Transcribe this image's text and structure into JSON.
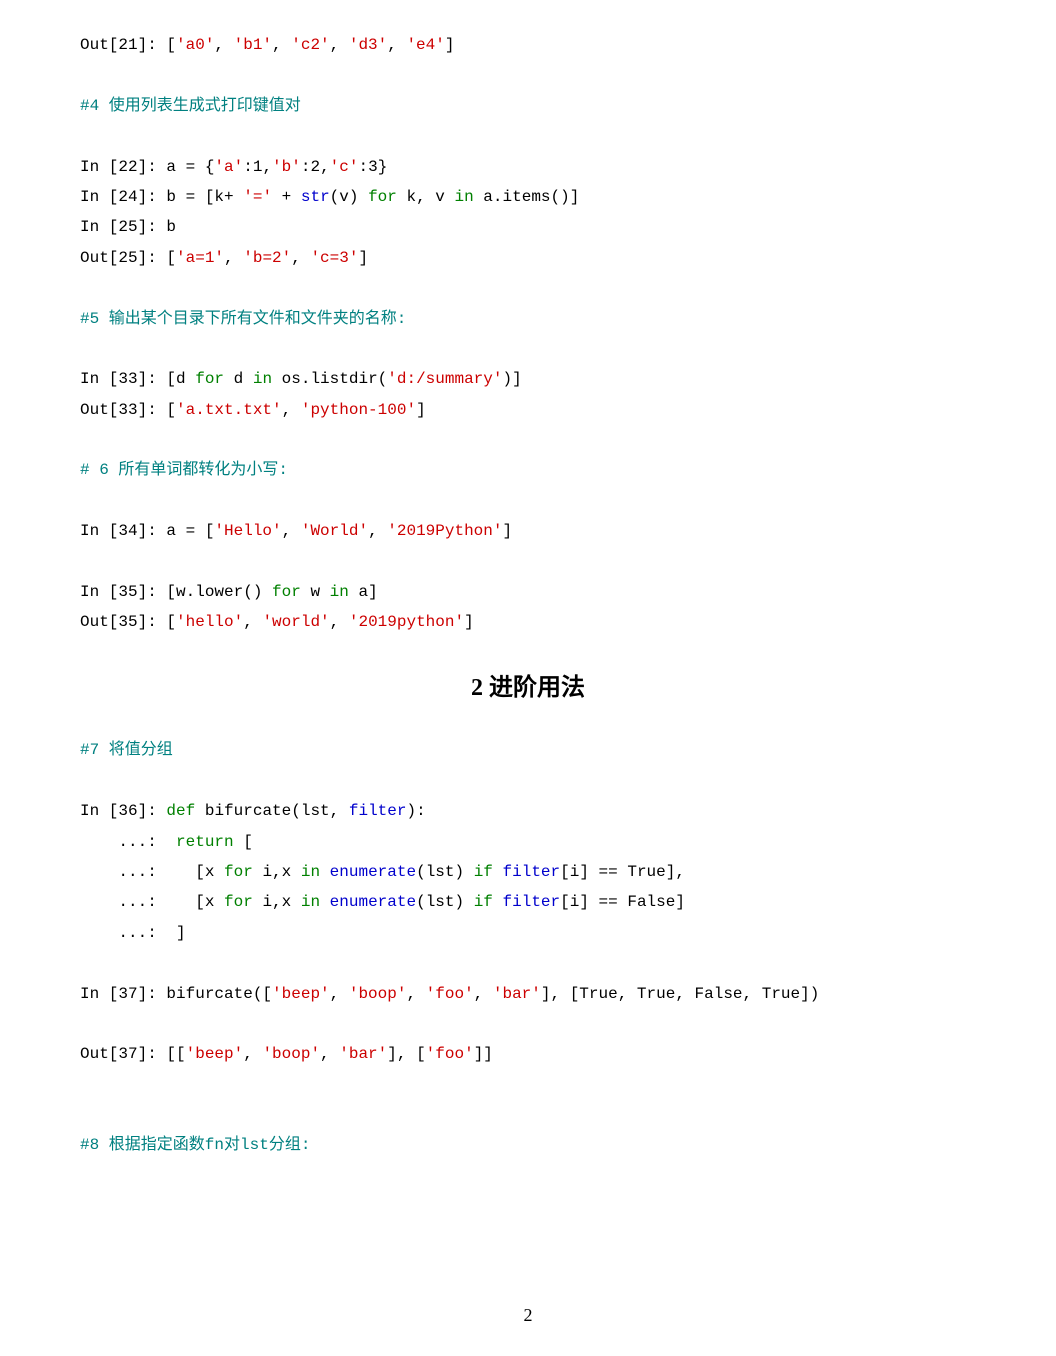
{
  "lines": [
    {
      "segs": [
        {
          "t": "Out[21]: ["
        },
        {
          "t": "'a0'",
          "c": "red"
        },
        {
          "t": ", "
        },
        {
          "t": "'b1'",
          "c": "red"
        },
        {
          "t": ", "
        },
        {
          "t": "'c2'",
          "c": "red"
        },
        {
          "t": ", "
        },
        {
          "t": "'d3'",
          "c": "red"
        },
        {
          "t": ", "
        },
        {
          "t": "'e4'",
          "c": "red"
        },
        {
          "t": "]"
        }
      ]
    },
    {
      "blank": true
    },
    {
      "segs": [
        {
          "t": "#4 使用列表生成式打印键值对",
          "c": "teal"
        }
      ]
    },
    {
      "blank": true
    },
    {
      "segs": [
        {
          "t": "In [22]: a = {"
        },
        {
          "t": "'a'",
          "c": "red"
        },
        {
          "t": ":1,"
        },
        {
          "t": "'b'",
          "c": "red"
        },
        {
          "t": ":2,"
        },
        {
          "t": "'c'",
          "c": "red"
        },
        {
          "t": ":3}"
        }
      ]
    },
    {
      "segs": [
        {
          "t": "In [24]: b = [k+ "
        },
        {
          "t": "'='",
          "c": "red"
        },
        {
          "t": " + "
        },
        {
          "t": "str",
          "c": "blue"
        },
        {
          "t": "(v) "
        },
        {
          "t": "for",
          "c": "green"
        },
        {
          "t": " k, v "
        },
        {
          "t": "in",
          "c": "green"
        },
        {
          "t": " a.items()]"
        }
      ]
    },
    {
      "segs": [
        {
          "t": "In [25]: b"
        }
      ]
    },
    {
      "segs": [
        {
          "t": "Out[25]: ["
        },
        {
          "t": "'a=1'",
          "c": "red"
        },
        {
          "t": ", "
        },
        {
          "t": "'b=2'",
          "c": "red"
        },
        {
          "t": ", "
        },
        {
          "t": "'c=3'",
          "c": "red"
        },
        {
          "t": "]"
        }
      ]
    },
    {
      "blank": true
    },
    {
      "segs": [
        {
          "t": "#5 输出某个目录下所有文件和文件夹的名称:",
          "c": "teal"
        }
      ]
    },
    {
      "blank": true
    },
    {
      "segs": [
        {
          "t": "In [33]: [d "
        },
        {
          "t": "for",
          "c": "green"
        },
        {
          "t": " d "
        },
        {
          "t": "in",
          "c": "green"
        },
        {
          "t": " os.listdir("
        },
        {
          "t": "'d:/summary'",
          "c": "red"
        },
        {
          "t": ")]"
        }
      ]
    },
    {
      "segs": [
        {
          "t": "Out[33]: ["
        },
        {
          "t": "'a.txt.txt'",
          "c": "red"
        },
        {
          "t": ", "
        },
        {
          "t": "'python-100'",
          "c": "red"
        },
        {
          "t": "]"
        }
      ]
    },
    {
      "blank": true
    },
    {
      "segs": [
        {
          "t": "# 6 所有单词都转化为小写:",
          "c": "teal"
        }
      ]
    },
    {
      "blank": true
    },
    {
      "segs": [
        {
          "t": "In [34]: a = ["
        },
        {
          "t": "'Hello'",
          "c": "red"
        },
        {
          "t": ", "
        },
        {
          "t": "'World'",
          "c": "red"
        },
        {
          "t": ", "
        },
        {
          "t": "'2019Python'",
          "c": "red"
        },
        {
          "t": "]"
        }
      ]
    },
    {
      "blank": true
    },
    {
      "segs": [
        {
          "t": "In [35]: [w.lower() "
        },
        {
          "t": "for",
          "c": "green"
        },
        {
          "t": " w "
        },
        {
          "t": "in",
          "c": "green"
        },
        {
          "t": " a]"
        }
      ]
    },
    {
      "segs": [
        {
          "t": "Out[35]: ["
        },
        {
          "t": "'hello'",
          "c": "red"
        },
        {
          "t": ", "
        },
        {
          "t": "'world'",
          "c": "red"
        },
        {
          "t": ", "
        },
        {
          "t": "'2019python'",
          "c": "red"
        },
        {
          "t": "]"
        }
      ]
    }
  ],
  "section_title": "2   进阶用法",
  "lines2": [
    {
      "segs": [
        {
          "t": "#7 将值分组",
          "c": "teal"
        }
      ]
    },
    {
      "blank": true
    },
    {
      "segs": [
        {
          "t": "In [36]: "
        },
        {
          "t": "def",
          "c": "green"
        },
        {
          "t": " bifurcate(lst, "
        },
        {
          "t": "filter",
          "c": "blue"
        },
        {
          "t": "):"
        }
      ]
    },
    {
      "segs": [
        {
          "t": "    ...:  "
        },
        {
          "t": "return",
          "c": "green"
        },
        {
          "t": " ["
        }
      ]
    },
    {
      "segs": [
        {
          "t": "    ...:    [x "
        },
        {
          "t": "for",
          "c": "green"
        },
        {
          "t": " i,x "
        },
        {
          "t": "in",
          "c": "green"
        },
        {
          "t": " "
        },
        {
          "t": "enumerate",
          "c": "blue"
        },
        {
          "t": "(lst) "
        },
        {
          "t": "if",
          "c": "green"
        },
        {
          "t": " "
        },
        {
          "t": "filter",
          "c": "blue"
        },
        {
          "t": "[i] == True],"
        }
      ]
    },
    {
      "segs": [
        {
          "t": "    ...:    [x "
        },
        {
          "t": "for",
          "c": "green"
        },
        {
          "t": " i,x "
        },
        {
          "t": "in",
          "c": "green"
        },
        {
          "t": " "
        },
        {
          "t": "enumerate",
          "c": "blue"
        },
        {
          "t": "(lst) "
        },
        {
          "t": "if",
          "c": "green"
        },
        {
          "t": " "
        },
        {
          "t": "filter",
          "c": "blue"
        },
        {
          "t": "[i] == False]"
        }
      ]
    },
    {
      "segs": [
        {
          "t": "    ...:  ]"
        }
      ]
    },
    {
      "blank": true
    },
    {
      "segs": [
        {
          "t": "In [37]: bifurcate(["
        },
        {
          "t": "'beep'",
          "c": "red"
        },
        {
          "t": ", "
        },
        {
          "t": "'boop'",
          "c": "red"
        },
        {
          "t": ", "
        },
        {
          "t": "'foo'",
          "c": "red"
        },
        {
          "t": ", "
        },
        {
          "t": "'bar'",
          "c": "red"
        },
        {
          "t": "], [True, True, False, True])"
        }
      ]
    },
    {
      "blank": true
    },
    {
      "segs": [
        {
          "t": "Out[37]: [["
        },
        {
          "t": "'beep'",
          "c": "red"
        },
        {
          "t": ", "
        },
        {
          "t": "'boop'",
          "c": "red"
        },
        {
          "t": ", "
        },
        {
          "t": "'bar'",
          "c": "red"
        },
        {
          "t": "], ["
        },
        {
          "t": "'foo'",
          "c": "red"
        },
        {
          "t": "]]"
        }
      ]
    },
    {
      "blank": true
    },
    {
      "blank": true
    },
    {
      "segs": [
        {
          "t": "#8 根据指定函数fn对lst分组:",
          "c": "teal"
        }
      ]
    }
  ],
  "page_number": "2"
}
